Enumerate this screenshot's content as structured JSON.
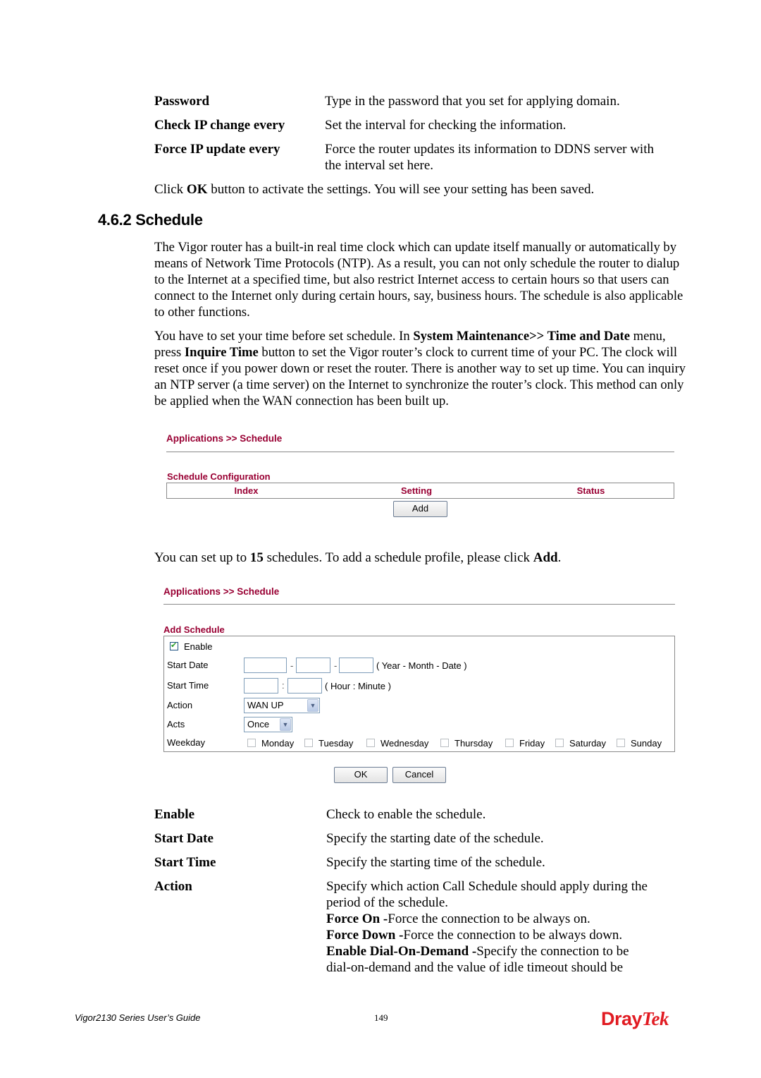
{
  "definitions_top": [
    {
      "term": "Password",
      "desc": [
        "Type in the password that you set for applying domain."
      ]
    },
    {
      "term": "Check IP change every",
      "desc": [
        "Set the interval for checking the information."
      ]
    },
    {
      "term": "Force IP update every",
      "desc": [
        "Force the router updates its information to DDNS server with",
        "the interval set here."
      ]
    }
  ],
  "click_ok": {
    "pre": "Click ",
    "bold": "OK",
    "post": " button to activate the settings. You will see your setting has been saved."
  },
  "section": {
    "title": "4.6.2 Schedule"
  },
  "intro_para": "The Vigor router has a built-in real time clock which can update itself manually or automatically by means of Network Time Protocols (NTP). As a result, you can not only schedule the router to dialup to the Internet at a specified time, but also restrict Internet access to certain hours so that users can connect to the Internet only during certain hours, say, business hours. The schedule is also applicable to other functions.",
  "time_para": {
    "p1": "You have to set your time before set schedule. In ",
    "b1": "System Maintenance>> Time and Date",
    "p2": " menu, press ",
    "b2": "Inquire Time",
    "p3": " button to set the Vigor router’s clock to current time of your PC. The clock will reset once if you power down or reset the router. There is another way to set up time. You can inquiry an NTP server (a time server) on the Internet to synchronize the router’s clock. This method can only be applied when the WAN connection has been built up."
  },
  "screen1": {
    "title": "Applications >> Schedule",
    "subtitle": "Schedule Configuration",
    "columns": [
      "Index",
      "Setting",
      "Status"
    ],
    "add_button": "Add"
  },
  "limit_para": {
    "p1": "You can set up to ",
    "b1": "15",
    "p2": " schedules. To add a schedule profile, please click ",
    "b2": "Add",
    "p3": "."
  },
  "screen2": {
    "title": "Applications >> Schedule",
    "subtitle": "Add Schedule",
    "enable_label": "Enable",
    "enable_checked": true,
    "start_date_label": "Start Date",
    "start_date_values": [
      "",
      "",
      ""
    ],
    "date_sep": "-",
    "date_hint": "( Year - Month - Date )",
    "start_time_label": "Start Time",
    "start_time_values": [
      "",
      ""
    ],
    "time_sep": ":",
    "time_hint": "( Hour : Minute )",
    "action_label": "Action",
    "action_value": "WAN UP",
    "acts_label": "Acts",
    "acts_value": "Once",
    "weekday_label": "Weekday",
    "weekdays": [
      {
        "label": "Monday",
        "checked": false
      },
      {
        "label": "Tuesday",
        "checked": false
      },
      {
        "label": "Wednesday",
        "checked": false
      },
      {
        "label": "Thursday",
        "checked": false
      },
      {
        "label": "Friday",
        "checked": false
      },
      {
        "label": "Saturday",
        "checked": false
      },
      {
        "label": "Sunday",
        "checked": false
      }
    ],
    "ok_button": "OK",
    "cancel_button": "Cancel"
  },
  "definitions_bottom": [
    {
      "term": "Enable",
      "desc": "Check to enable the schedule."
    },
    {
      "term": "Start Date",
      "desc": "Specify the starting date of the schedule."
    },
    {
      "term": "Start Time",
      "desc": "Specify the starting time of the schedule."
    },
    {
      "term": "Action",
      "desc": "Specify which action Call Schedule should apply during the",
      "desc2": "period of the schedule."
    }
  ],
  "action_options": [
    {
      "bold": "Force On -",
      "text": "Force the connection to be always on."
    },
    {
      "bold": "Force Down -",
      "text": "Force the connection to be always down."
    },
    {
      "bold": "Enable Dial-On-Demand -",
      "text": "Specify the connection to be"
    }
  ],
  "action_last_line": "dial-on-demand and the value of idle timeout should be",
  "footer": {
    "guide": "Vigor2130 Series User’s Guide",
    "page": "149",
    "logo_part1": "Dray",
    "logo_part2": "Tek",
    "logo_color": "#e11b22"
  },
  "colors": {
    "ui_title": "#990033",
    "input_border": "#7f9db9"
  }
}
